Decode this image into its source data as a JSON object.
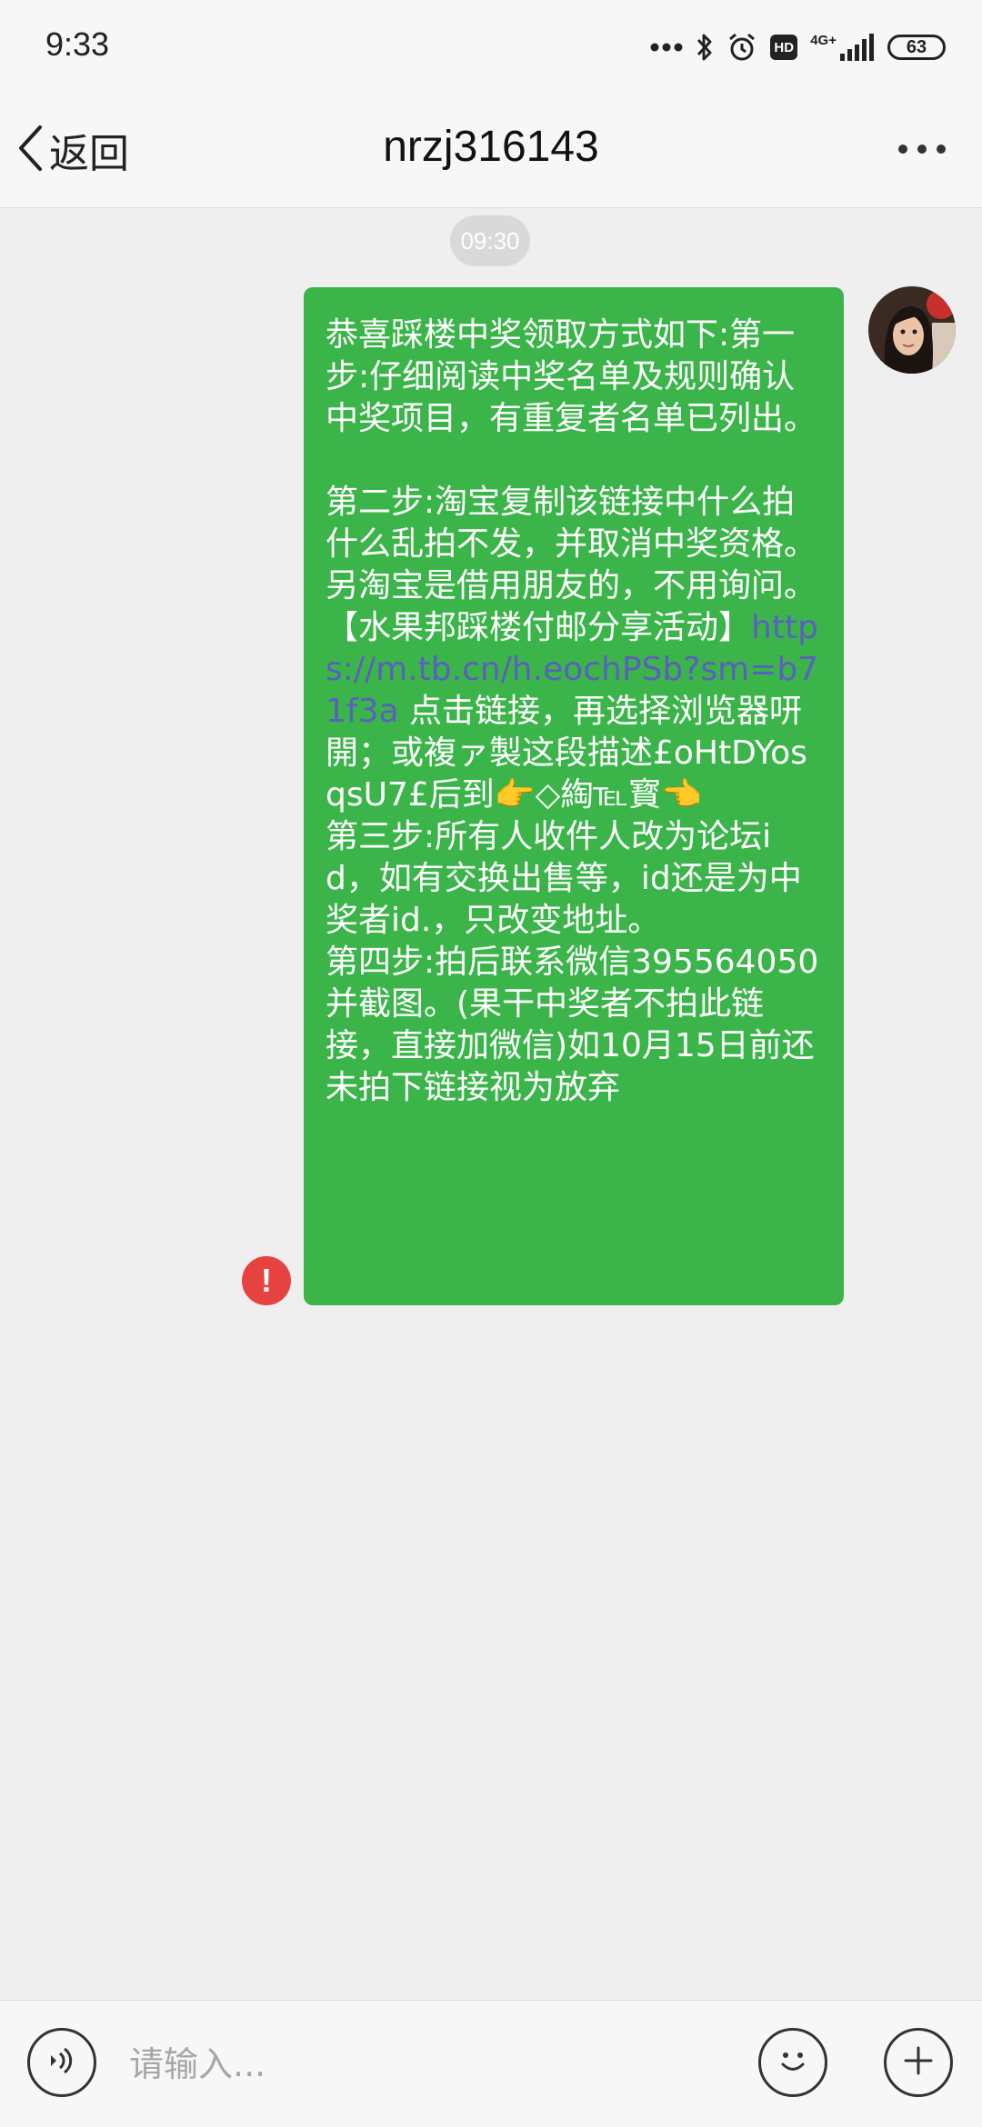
{
  "status_bar": {
    "time": "9:33",
    "network": "4G+",
    "hd_label": "HD",
    "battery": "63"
  },
  "header": {
    "back_label": "返回",
    "title": "nrzj316143"
  },
  "chat": {
    "timestamp": "09:30",
    "message": {
      "part1": "恭喜踩楼中奖领取方式如下:第一步:仔细阅读中奖名单及规则确认中奖项目，有重复者名单已列出。\n\n第二步:淘宝复制该链接中什么拍什么乱拍不发，并取消中奖资格。另淘宝是借用朋友的，不用询问。\n【水果邦踩楼付邮分享活动】",
      "link": "https://m.tb.cn/h.eochPSb?sm=b71f3a",
      "part2": " 点击链接，再选择浏览器咞開；或複ァ製这段描述£oHtDYosqsU7£后到👉◇綯℡寳👈\n第三步:所有人收件人改为论坛id，如有交换出售等，id还是为中奖者id.，只改变地址。\n第四步:拍后联系微信395564050并截图。(果干中奖者不拍此链接，直接加微信)如10月15日前还未拍下链接视为放弃",
      "status": "failed",
      "error_mark": "!"
    }
  },
  "input_bar": {
    "placeholder": "请输入..."
  }
}
